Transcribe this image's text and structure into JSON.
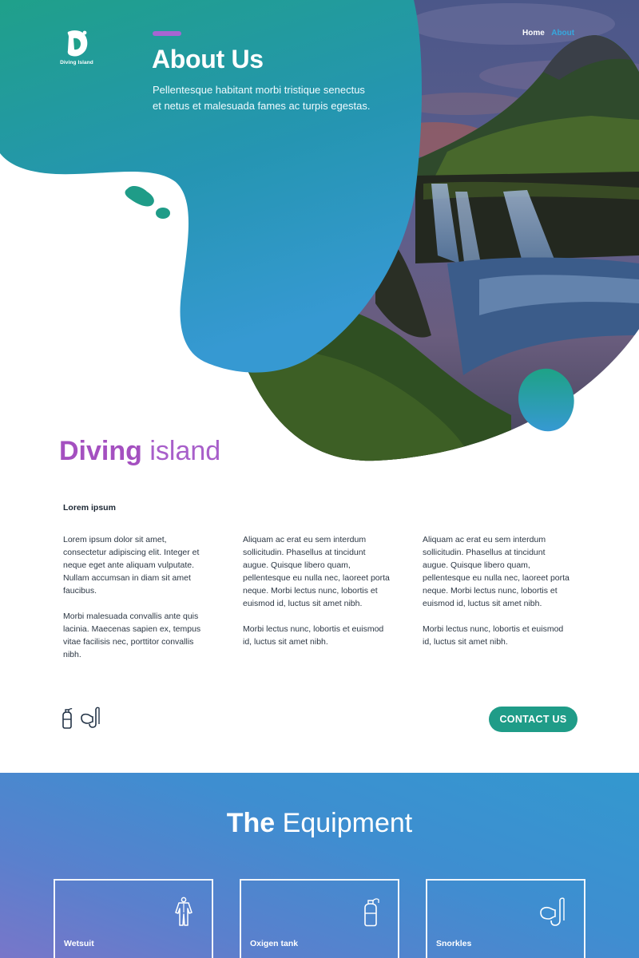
{
  "brand": {
    "name": "Diving Island"
  },
  "nav": {
    "items": [
      "Home",
      "About"
    ],
    "active": "About"
  },
  "hero": {
    "title": "About Us",
    "description": "Pellentesque habitant morbi tristique senectus et netus et malesuada fames ac turpis egestas."
  },
  "intro": {
    "heading_strong": "Diving",
    "heading_light": "island",
    "subheading": "Lorem ipsum",
    "columns": [
      [
        "Lorem ipsum dolor sit amet, consectetur adipiscing elit. Integer et neque eget ante aliquam vulputate. Nullam accumsan in diam sit amet faucibus.",
        "Morbi malesuada convallis ante quis lacinia. Maecenas sapien ex, tempus vitae facilisis nec, porttitor convallis nibh."
      ],
      [
        "Aliquam ac erat eu sem interdum sollicitudin. Phasellus at tincidunt augue. Quisque libero quam, pellentesque eu nulla nec, laoreet porta neque. Morbi lectus nunc, lobortis et euismod id, luctus sit amet nibh.",
        "Morbi lectus nunc, lobortis et euismod id, luctus sit amet nibh."
      ],
      [
        "Aliquam ac erat eu sem interdum sollicitudin. Phasellus at tincidunt augue. Quisque libero quam, pellentesque eu nulla nec, laoreet porta neque. Morbi lectus nunc, lobortis et euismod id, luctus sit amet nibh.",
        "Morbi lectus nunc, lobortis et euismod id, luctus sit amet nibh."
      ]
    ],
    "icons": [
      "oxygen-tank-icon",
      "snorkel-icon"
    ],
    "cta": "CONTACT US"
  },
  "equipment": {
    "title_strong": "The",
    "title_light": "Equipment",
    "items": [
      {
        "label": "Wetsuit",
        "icon": "wetsuit-icon"
      },
      {
        "label": "Oxigen tank",
        "icon": "oxygen-tank-icon"
      },
      {
        "label": "Snorkles",
        "icon": "snorkel-icon"
      }
    ]
  },
  "colors": {
    "teal": "#1f9c88",
    "blue": "#3399d0",
    "purple": "#a450c0",
    "nav_active": "#36a8de"
  }
}
